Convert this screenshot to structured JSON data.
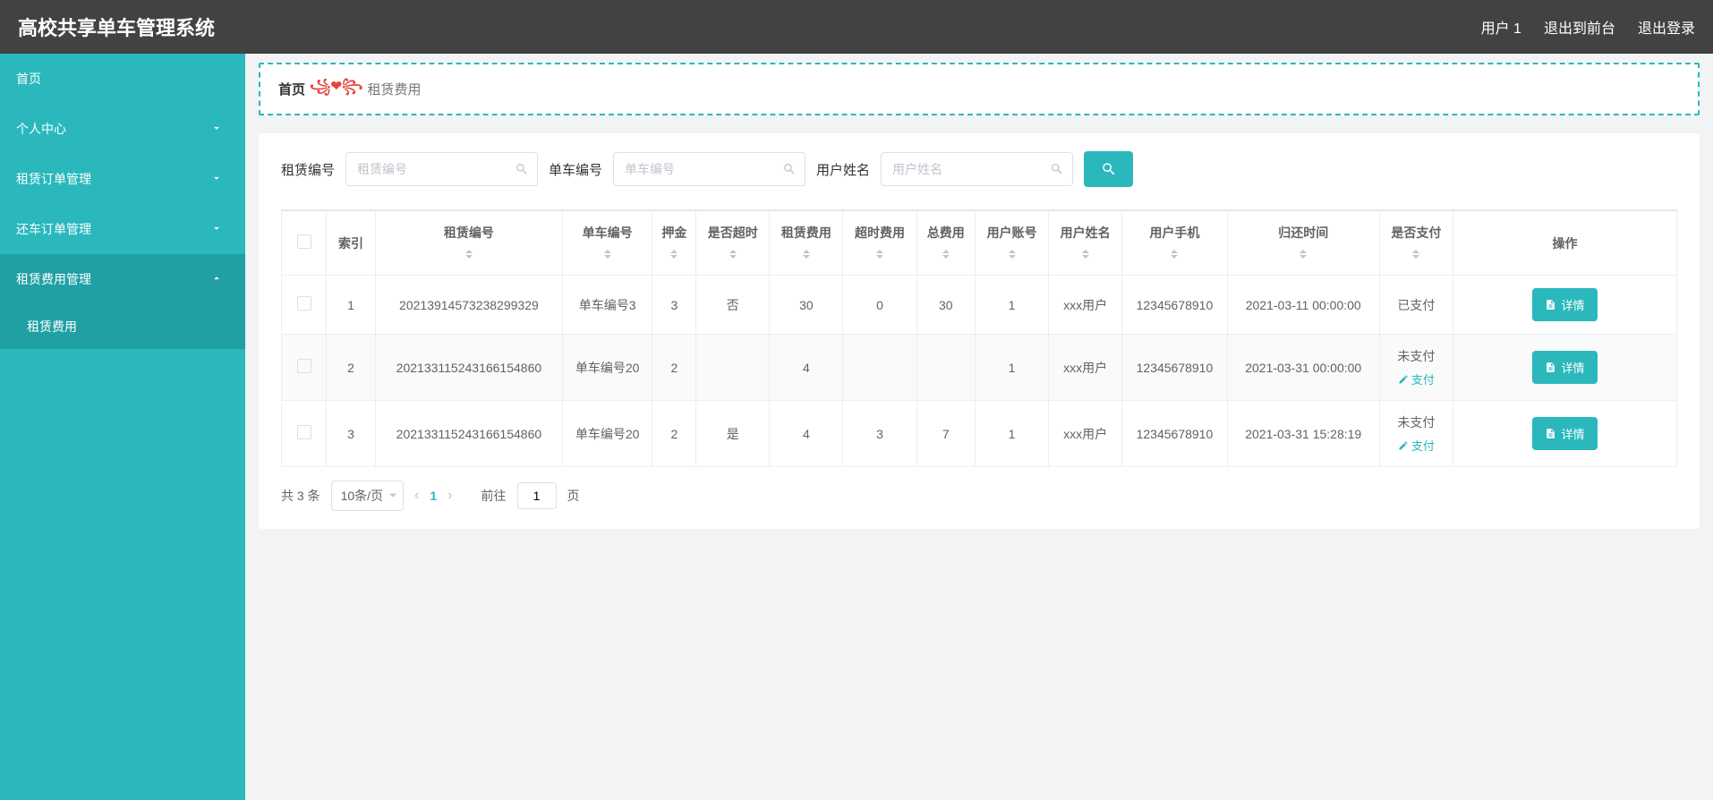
{
  "header": {
    "title": "高校共享单车管理系统",
    "user_label": "用户 1",
    "front_label": "退出到前台",
    "logout_label": "退出登录"
  },
  "sidebar": {
    "items": [
      {
        "label": "首页",
        "expandable": false
      },
      {
        "label": "个人中心",
        "expandable": true,
        "open": false
      },
      {
        "label": "租赁订单管理",
        "expandable": true,
        "open": false
      },
      {
        "label": "还车订单管理",
        "expandable": true,
        "open": false
      },
      {
        "label": "租赁费用管理",
        "expandable": true,
        "open": true,
        "children": [
          {
            "label": "租赁费用",
            "active": true
          }
        ]
      }
    ]
  },
  "breadcrumb": {
    "home": "首页",
    "wave": "꧁❤꧂",
    "current": "租赁费用"
  },
  "filters": [
    {
      "label": "租赁编号",
      "placeholder": "租赁编号",
      "name": "rent-no"
    },
    {
      "label": "单车编号",
      "placeholder": "单车编号",
      "name": "bike-no"
    },
    {
      "label": "用户姓名",
      "placeholder": "用户姓名",
      "name": "user-name"
    }
  ],
  "table": {
    "columns": [
      "",
      "索引",
      "租赁编号",
      "单车编号",
      "押金",
      "是否超时",
      "租赁费用",
      "超时费用",
      "总费用",
      "用户账号",
      "用户姓名",
      "用户手机",
      "归还时间",
      "是否支付",
      "操作"
    ],
    "rows": [
      {
        "idx": "1",
        "rent": "20213914573238299329",
        "bike": "单车编号3",
        "deposit": "3",
        "overtime": "否",
        "rent_fee": "30",
        "ot_fee": "0",
        "total": "30",
        "acct": "1",
        "uname": "xxx用户",
        "phone": "12345678910",
        "ret": "2021-03-11 00:00:00",
        "paid": "已支付",
        "show_pay": false
      },
      {
        "idx": "2",
        "rent": "202133115243166154860",
        "bike": "单车编号20",
        "deposit": "2",
        "overtime": "",
        "rent_fee": "4",
        "ot_fee": "",
        "total": "",
        "acct": "1",
        "uname": "xxx用户",
        "phone": "12345678910",
        "ret": "2021-03-31 00:00:00",
        "paid": "未支付",
        "show_pay": true
      },
      {
        "idx": "3",
        "rent": "202133115243166154860",
        "bike": "单车编号20",
        "deposit": "2",
        "overtime": "是",
        "rent_fee": "4",
        "ot_fee": "3",
        "total": "7",
        "acct": "1",
        "uname": "xxx用户",
        "phone": "12345678910",
        "ret": "2021-03-31 15:28:19",
        "paid": "未支付",
        "show_pay": true
      }
    ],
    "detail_label": "详情",
    "pay_label": "支付"
  },
  "pagination": {
    "total": "共 3 条",
    "page_size": "10条/页",
    "current": "1",
    "goto_prefix": "前往",
    "goto_value": "1",
    "goto_suffix": "页"
  }
}
